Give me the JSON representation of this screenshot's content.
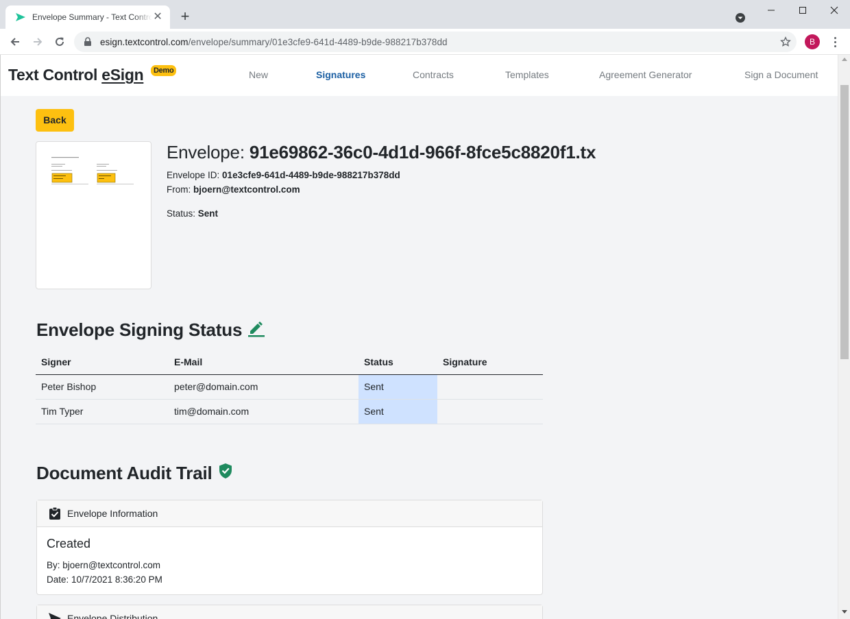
{
  "browser": {
    "tab_title": "Envelope Summary - Text Control eSign",
    "url_host": "esign.textcontrol.com",
    "url_path": "/envelope/summary/01e3cfe9-641d-4489-b9de-988217b378dd",
    "profile_initial": "B"
  },
  "site": {
    "brand_prefix": "Text Control ",
    "brand_name": "eSign",
    "badge": "Demo",
    "nav": {
      "new": "New",
      "signatures": "Signatures",
      "contracts": "Contracts",
      "templates": "Templates",
      "agreement_generator": "Agreement Generator",
      "sign_document": "Sign a Document"
    },
    "active_nav": "Signatures",
    "brand_color": "#fdc010",
    "active_color": "#1b5fa3"
  },
  "envelope": {
    "back_label": "Back",
    "title_label": "Envelope: ",
    "title_value": "91e69862-36c0-4d1d-966f-8fce5c8820f1.tx",
    "id_label": "Envelope ID: ",
    "id_value": "01e3cfe9-641d-4489-b9de-988217b378dd",
    "from_label": "From: ",
    "from_value": "bjoern@textcontrol.com",
    "status_label": "Status: ",
    "status_value": "Sent"
  },
  "signing_status": {
    "heading": "Envelope Signing Status",
    "columns": {
      "signer": "Signer",
      "email": "E-Mail",
      "status": "Status",
      "signature": "Signature"
    },
    "rows": [
      {
        "signer": "Peter Bishop",
        "email": "peter@domain.com",
        "status": "Sent",
        "signature": ""
      },
      {
        "signer": "Tim Typer",
        "email": "tim@domain.com",
        "status": "Sent",
        "signature": ""
      }
    ]
  },
  "audit_trail": {
    "heading": "Document Audit Trail",
    "info_card": {
      "header": "Envelope Information",
      "title": "Created",
      "by_label": "By: ",
      "by_value": "bjoern@textcontrol.com",
      "date_label": "Date: ",
      "date_value": "10/7/2021 8:36:20 PM"
    },
    "distribution_card": {
      "header": "Envelope Distribution"
    }
  }
}
